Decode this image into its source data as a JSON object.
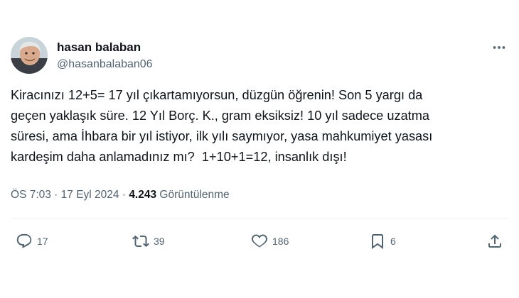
{
  "author": {
    "display_name": "hasan balaban",
    "handle": "@hasanbalaban06"
  },
  "tweet": {
    "text": "Kiracınızı 12+5= 17 yıl çıkartamıyorsun, düzgün öğrenin! Son 5 yargı da\ngeçen yaklaşık süre. 12 Yıl Borç. K., gram eksiksiz! 10 yıl sadece uzatma\nsüresi, ama İhbara bir yıl istiyor, ilk yılı saymıyor, yasa mahkumiyet yasası\nkardeşim daha anlamadınız mı?  1+10+1=12, insanlık dışı!"
  },
  "meta": {
    "time": "ÖS 7:03",
    "separator1": " · ",
    "date": "17 Eyl 2024",
    "separator2": " · ",
    "views_count": "4.243",
    "views_label": " Görüntülenme"
  },
  "actions": {
    "replies": "17",
    "reposts": "39",
    "likes": "186",
    "bookmarks": "6"
  },
  "icons": {
    "more": "more-icon",
    "reply": "reply-icon",
    "repost": "repost-icon",
    "like": "like-icon",
    "bookmark": "bookmark-icon",
    "share": "share-icon"
  }
}
